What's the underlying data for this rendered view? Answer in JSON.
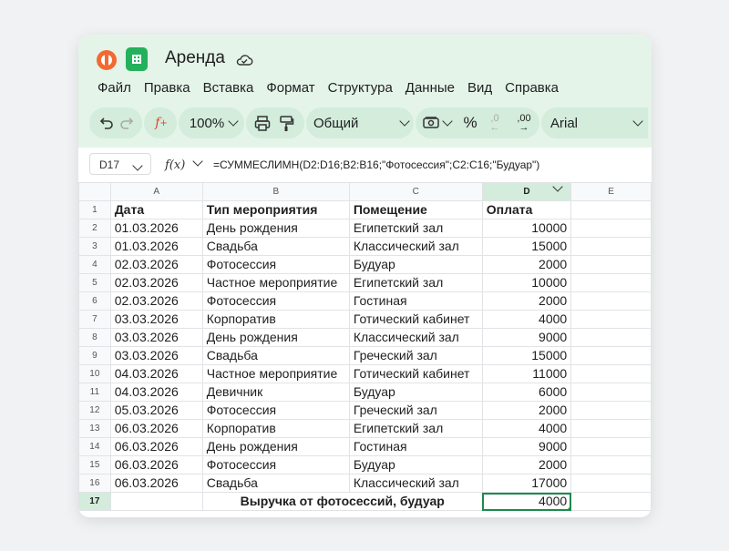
{
  "app": {
    "doc_title": "Аренда",
    "menu": [
      "Файл",
      "Правка",
      "Вставка",
      "Формат",
      "Структура",
      "Данные",
      "Вид",
      "Справка"
    ]
  },
  "toolbar": {
    "zoom": "100%",
    "number_format": "Общий",
    "percent": "%",
    "dec_minus": ",0",
    "dec_plus": ",00",
    "font": "Arial"
  },
  "formula_bar": {
    "cell_ref": "D17",
    "fx_label": "f(x)",
    "formula": "=СУММЕСЛИМН(D2:D16;B2:B16;\"Фотосессия\";C2:C16;\"Будуар\")"
  },
  "sheet": {
    "columns": [
      "A",
      "B",
      "C",
      "D",
      "E"
    ],
    "header": [
      "Дата",
      "Тип мероприятия",
      "Помещение",
      "Оплата"
    ],
    "rows": [
      [
        "01.03.2026",
        "День рождения",
        "Египетский зал",
        "10000"
      ],
      [
        "01.03.2026",
        "Свадьба",
        "Классический зал",
        "15000"
      ],
      [
        "02.03.2026",
        "Фотосессия",
        "Будуар",
        "2000"
      ],
      [
        "02.03.2026",
        "Частное мероприятие",
        "Египетский зал",
        "10000"
      ],
      [
        "02.03.2026",
        "Фотосессия",
        "Гостиная",
        "2000"
      ],
      [
        "03.03.2026",
        "Корпоратив",
        "Готический кабинет",
        "4000"
      ],
      [
        "03.03.2026",
        "День рождения",
        "Классический зал",
        "9000"
      ],
      [
        "03.03.2026",
        "Свадьба",
        "Греческий зал",
        "15000"
      ],
      [
        "04.03.2026",
        "Частное мероприятие",
        "Готический кабинет",
        "11000"
      ],
      [
        "04.03.2026",
        "Девичник",
        "Будуар",
        "6000"
      ],
      [
        "05.03.2026",
        "Фотосессия",
        "Греческий зал",
        "2000"
      ],
      [
        "06.03.2026",
        "Корпоратив",
        "Египетский зал",
        "4000"
      ],
      [
        "06.03.2026",
        "День рождения",
        "Гостиная",
        "9000"
      ],
      [
        "06.03.2026",
        "Фотосессия",
        "Будуар",
        "2000"
      ],
      [
        "06.03.2026",
        "Свадьба",
        "Классический зал",
        "17000"
      ]
    ],
    "total_label": "Выручка от фотосессий, будуар",
    "total_value": "4000"
  },
  "colors": {
    "accent": "#1d8a4c",
    "toolbar_bg": "#e4f4e9"
  }
}
